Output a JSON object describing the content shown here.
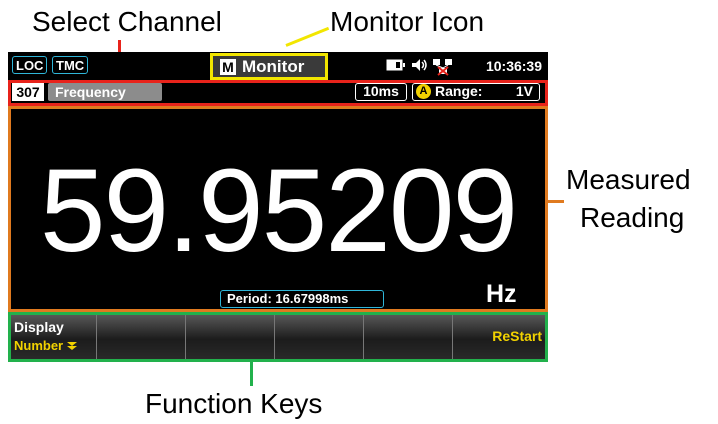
{
  "callouts": {
    "select_channel": "Select Channel",
    "monitor_icon": "Monitor Icon",
    "measured_line1": "Measured",
    "measured_line2": "Reading",
    "function_keys": "Function Keys"
  },
  "status": {
    "loc": "LOC",
    "tmc": "TMC",
    "mode_icon": "M",
    "mode_label": "Monitor",
    "clock": "10:36:39",
    "icons": [
      "battery-icon",
      "speaker-icon",
      "network-icon"
    ]
  },
  "channel": {
    "number": "307",
    "function": "Frequency",
    "rate": "10ms",
    "auto_badge": "A",
    "range_label": "Range:",
    "range_value": "1V"
  },
  "measurement": {
    "value": "59.95209",
    "unit": "Hz",
    "period": "Period:  16.67998ms"
  },
  "function_keys": [
    {
      "line1": "Display",
      "line2": "Number"
    },
    {
      "line1": "",
      "line2": ""
    },
    {
      "line1": "",
      "line2": ""
    },
    {
      "line1": "",
      "line2": ""
    },
    {
      "line1": "",
      "line2": ""
    },
    {
      "line1": "ReStart",
      "line2": ""
    }
  ],
  "colors": {
    "select_channel_box": "#e8231b",
    "monitor_box": "#f2e600",
    "reading_box": "#e07a1f",
    "function_keys_box": "#22b14c",
    "accent_cyan": "#2fb6d9"
  }
}
